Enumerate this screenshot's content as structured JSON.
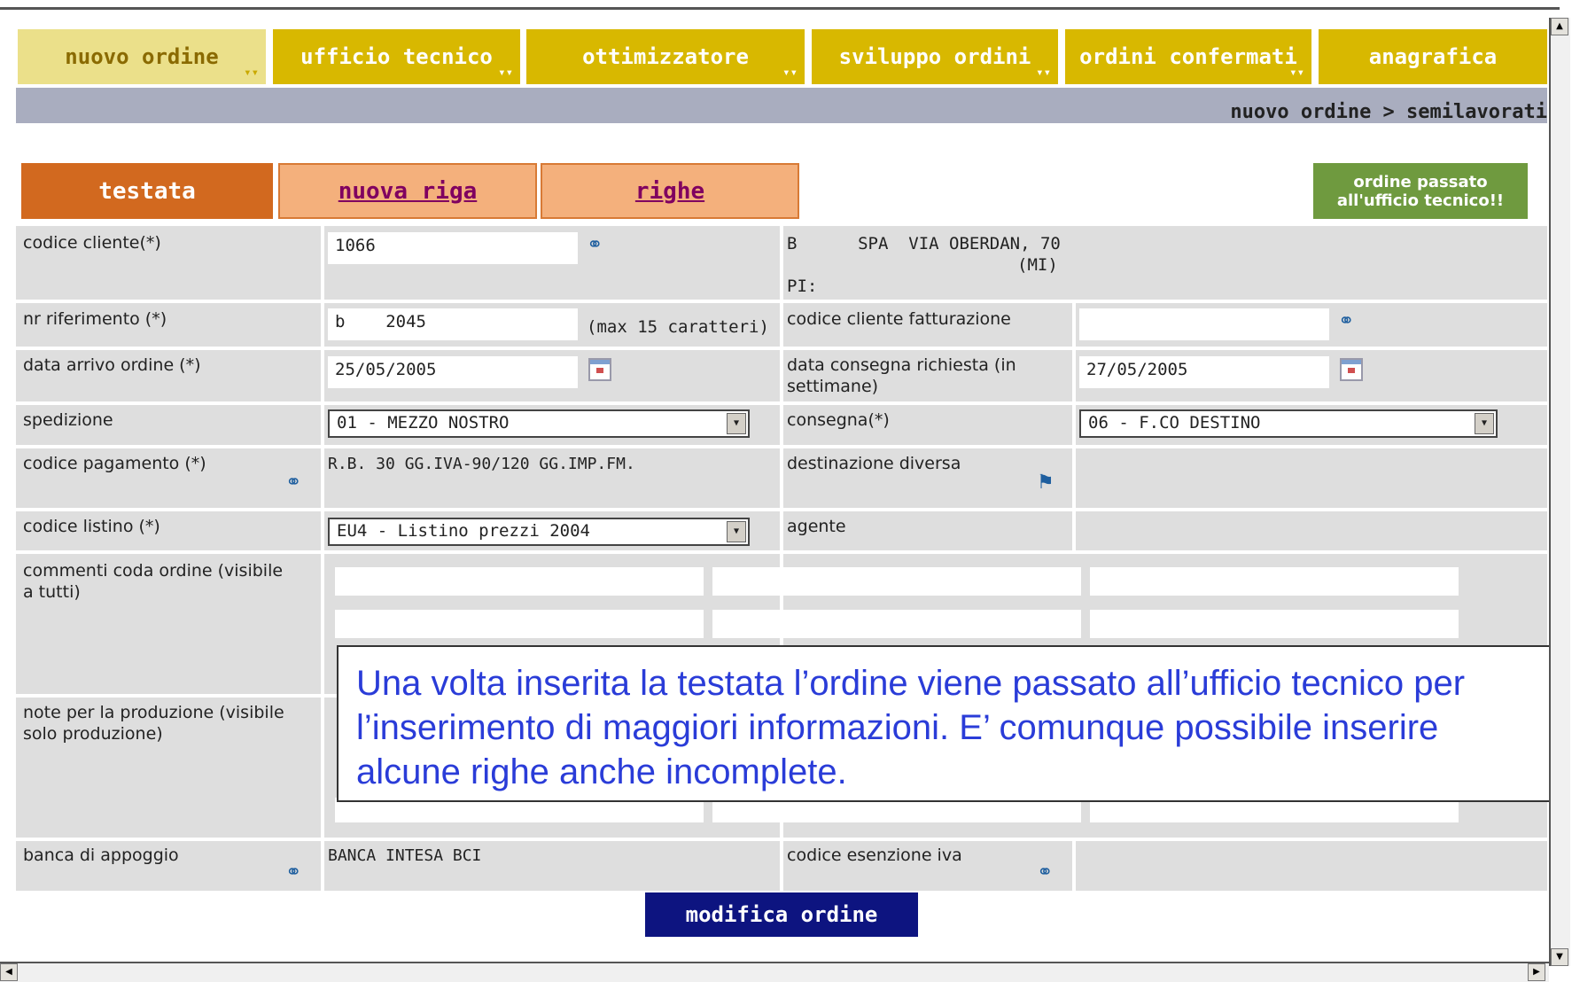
{
  "top_tabs": [
    "nuovo ordine",
    "ufficio tecnico",
    "ottimizzatore",
    "sviluppo ordini",
    "ordini confermati",
    "anagrafica"
  ],
  "breadcrumb": "nuovo ordine > semilavorati",
  "sub_tabs": [
    "testata",
    "nuova riga",
    "righe"
  ],
  "status_badge": [
    "ordine passato",
    "all'ufficio tecnico!!"
  ],
  "form": {
    "codice_cliente_label": "codice cliente(*)",
    "codice_cliente_value": "1066",
    "client_info": [
      "B      SPA  VIA OBERDAN, 70",
      "(MI)",
      "PI:"
    ],
    "nr_riferimento_label": "nr riferimento (*)",
    "nr_riferimento_value": "b    2045",
    "max_hint": "(max 15 caratteri)",
    "codice_cliente_fatt_label": "codice cliente fatturazione",
    "codice_cliente_fatt_value": "",
    "data_arrivo_label": "data arrivo ordine (*)",
    "data_arrivo_value": "25/05/2005",
    "data_consegna_label": "data consegna richiesta (in settimane)",
    "data_consegna_value": "27/05/2005",
    "spedizione_label": "spedizione",
    "spedizione_value": "01 - MEZZO NOSTRO",
    "consegna_label": "consegna(*)",
    "consegna_value": "06 - F.CO DESTINO",
    "codice_pagamento_label": "codice pagamento (*)",
    "codice_pagamento_value": "R.B. 30 GG.IVA-90/120 GG.IMP.FM.",
    "destinazione_label": "destinazione diversa",
    "codice_listino_label": "codice listino (*)",
    "codice_listino_value": "EU4 - Listino prezzi 2004",
    "agente_label": "agente",
    "commenti_label": "commenti coda ordine (visibile a tutti)",
    "note_label": "note per la produzione (visibile solo produzione)",
    "banca_label": "banca di appoggio",
    "banca_value": "BANCA INTESA BCI",
    "esenzione_label": "codice esenzione iva"
  },
  "submit_label": "modifica ordine",
  "callout": "Una volta inserita la testata l’ordine viene passato all’ufficio tecnico per l’inserimento di maggiori informazioni. E’ comunque possibile inserire alcune righe anche incomplete.",
  "icons": [
    "binoculars-icon",
    "calendar-icon",
    "dropdown-arrow-icon",
    "destination-icon"
  ],
  "colors": {
    "tab_gold": "#d8b800",
    "active_tab": "#ebe08a",
    "testata_orange": "#d2691f",
    "submit_navy": "#0d1480",
    "status_green": "#6f9a3f",
    "callout_text": "#2a3cd8"
  }
}
